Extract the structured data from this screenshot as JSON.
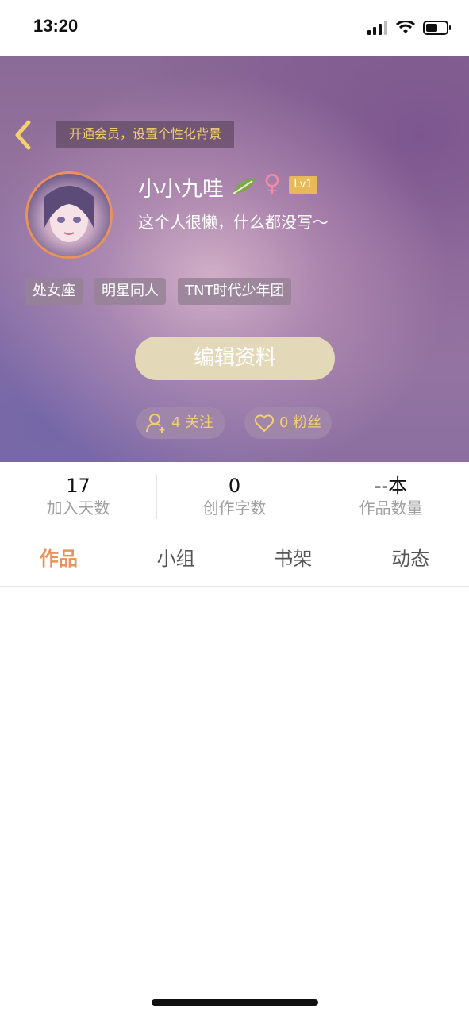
{
  "status": {
    "time": "13:20"
  },
  "header": {
    "vip_banner": "开通会员，设置个性化背景"
  },
  "profile": {
    "username": "小小九哇",
    "gender_symbol": "♀",
    "level": "Lv1",
    "bio": "这个人很懒，什么都没写～",
    "tags": [
      "处女座",
      "明星同人",
      "TNT时代少年团"
    ],
    "edit_button": "编辑资料",
    "following_label": "4 关注",
    "fans_label": "0 粉丝"
  },
  "stats": [
    {
      "value": "17",
      "label": "加入天数"
    },
    {
      "value": "0",
      "label": "创作字数"
    },
    {
      "value": "--本",
      "label": "作品数量"
    }
  ],
  "tabs": [
    "作品",
    "小组",
    "书架",
    "动态"
  ],
  "active_tab": "作品",
  "colors": {
    "accent": "#e9925a",
    "gold": "#f3cf6e",
    "edit_button": "#e3d9b8"
  }
}
